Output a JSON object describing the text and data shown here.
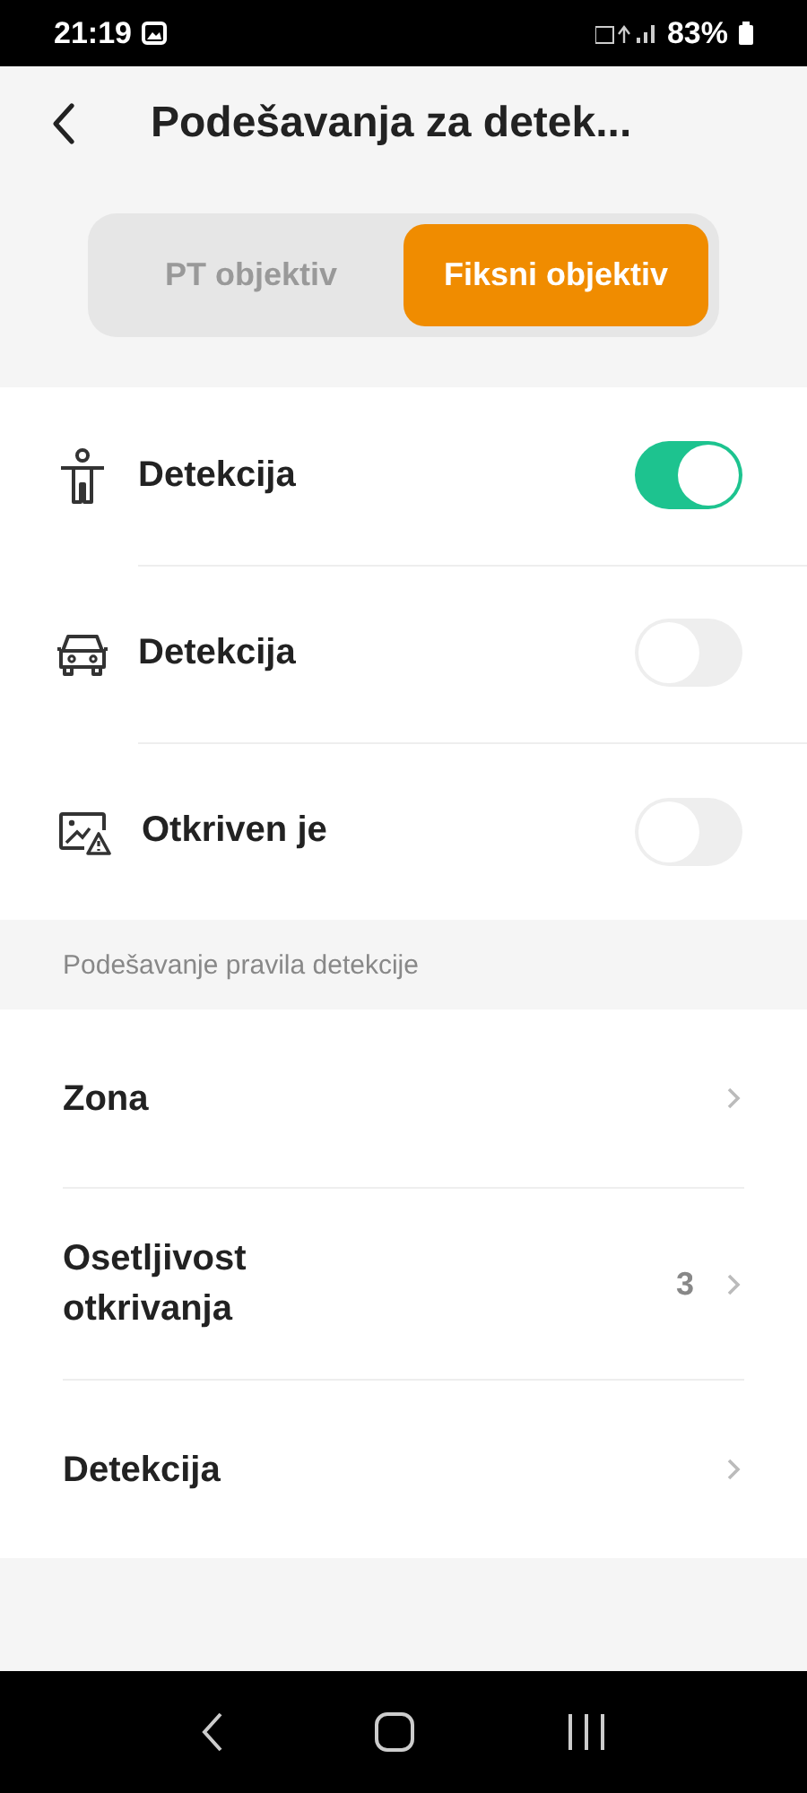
{
  "status_bar": {
    "time": "21:19",
    "battery": "83%"
  },
  "header": {
    "title": "Podešavanja za detek..."
  },
  "tabs": [
    {
      "label": "PT objektiv",
      "selected": false
    },
    {
      "label": "Fiksni objektiv",
      "selected": true
    }
  ],
  "toggles": [
    {
      "kind": "person",
      "label": "Detekcija",
      "on": true
    },
    {
      "kind": "car",
      "label": "Detekcija",
      "on": false
    },
    {
      "kind": "alert",
      "label": "Otkriven je",
      "on": false
    }
  ],
  "section": {
    "title": "Podešavanje pravila detekcije"
  },
  "rules": [
    {
      "label": "Zona"
    },
    {
      "label": "Osetljivost otkrivanja",
      "value": "3"
    },
    {
      "label": "Detekcija"
    }
  ]
}
